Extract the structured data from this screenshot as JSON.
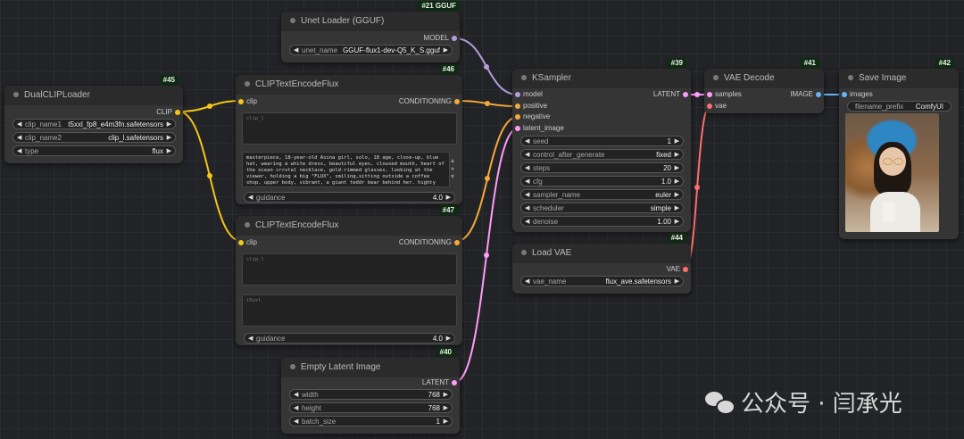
{
  "colors": {
    "clip": "#f5c518",
    "conditioning": "#f7a83a",
    "model": "#b39ddb",
    "latent": "#ff9cf9",
    "vae": "#ff6e6e",
    "image": "#64b5f6"
  },
  "nodes": {
    "unet": {
      "id": "#21 GGUF",
      "title": "Unet Loader (GGUF)",
      "out_model": "MODEL",
      "w_unet_name": "unet_name",
      "v_unet_name": "GGUF-flux1-dev-Q5_K_S.gguf"
    },
    "dualclip": {
      "id": "#45",
      "title": "DualCLIPLoader",
      "out_clip": "CLIP",
      "w_clip_name1": "clip_name1",
      "v_clip_name1": "t5xxl_fp8_e4m3fn.safetensors",
      "w_clip_name2": "clip_name2",
      "v_clip_name2": "clip_l.safetensors",
      "w_type": "type",
      "v_type": "flux"
    },
    "cliptext1": {
      "id": "#46",
      "title": "CLIPTextEncodeFlux",
      "in_clip": "clip",
      "out_conditioning": "CONDITIONING",
      "clip_l_placeholder": "clip_l",
      "t5xxl_text": "masterpiece, 18-year-old Asina girl, solo, 18 age, close-up, blue hat, wearing a white dress, beautiful eyes, cloused mouth, heart of the ocean crrstal necklace, gold-rimmed glasses, looking at the viewer, holding a big \"FLUX\", smiling,sitting outside a coffee shop, upper body, vibrant, a giant teddr bear behind her. highty detailed.",
      "w_guidance": "guidance",
      "v_guidance": "4.0"
    },
    "cliptext2": {
      "id": "#47",
      "title": "CLIPTextEncodeFlux",
      "in_clip": "clip",
      "out_conditioning": "CONDITIONING",
      "clip_l_placeholder": "clip_l",
      "t5xxl_placeholder": "t5xxl",
      "w_guidance": "guidance",
      "v_guidance": "4.0"
    },
    "ksampler": {
      "id": "#39",
      "title": "KSampler",
      "in_model": "model",
      "in_positive": "positive",
      "in_negative": "negative",
      "in_latent": "latent_image",
      "out_latent": "LATENT",
      "widgets": [
        {
          "name": "seed",
          "value": "1"
        },
        {
          "name": "control_after_generate",
          "value": "fixed"
        },
        {
          "name": "steps",
          "value": "20"
        },
        {
          "name": "cfg",
          "value": "1.0"
        },
        {
          "name": "sampler_name",
          "value": "euler"
        },
        {
          "name": "scheduler",
          "value": "simple"
        },
        {
          "name": "denoise",
          "value": "1.00"
        }
      ]
    },
    "loadvae": {
      "id": "#44",
      "title": "Load VAE",
      "out_vae": "VAE",
      "w_vae_name": "vae_name",
      "v_vae_name": "flux_ave.safetensors"
    },
    "vaedecode": {
      "id": "#41",
      "title": "VAE Decode",
      "in_samples": "samples",
      "in_vae": "vae",
      "out_image": "IMAGE"
    },
    "saveimage": {
      "id": "#42",
      "title": "Save Image",
      "in_images": "images",
      "w_filename_prefix": "filename_prefix",
      "v_filename_prefix": "ComfyUI"
    },
    "emptylatent": {
      "id": "#40",
      "title": "Empty Latent Image",
      "out_latent": "LATENT",
      "w_width": "width",
      "v_width": "768",
      "w_height": "height",
      "v_height": "768",
      "w_batch_size": "batch_size",
      "v_batch_size": "1"
    }
  },
  "watermark": {
    "text": "公众号 · 闫承光"
  }
}
